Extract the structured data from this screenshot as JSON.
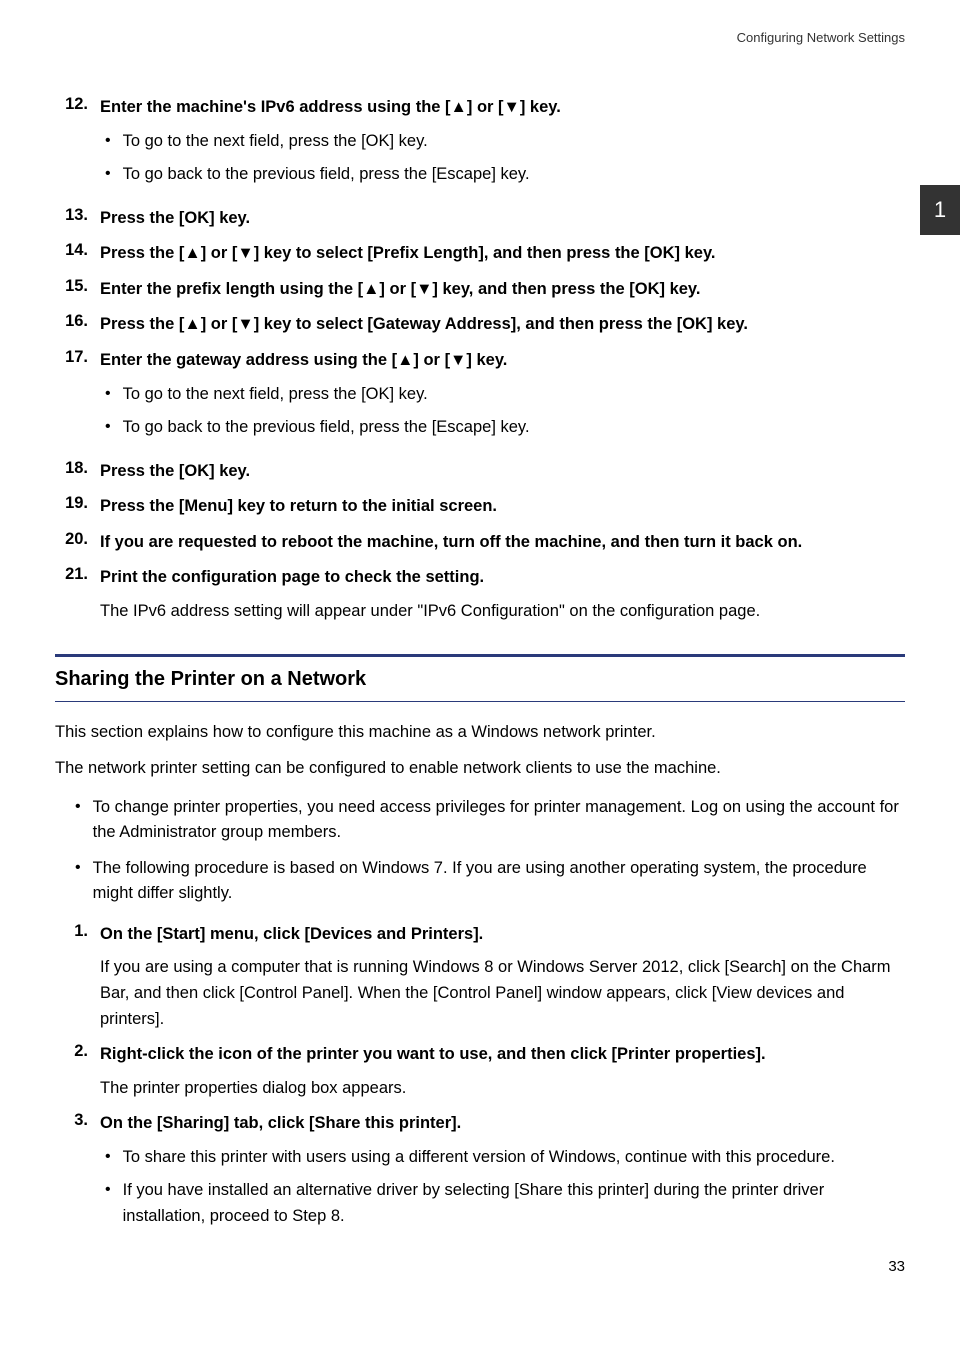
{
  "header": {
    "title": "Configuring Network Settings"
  },
  "sideTab": {
    "number": "1"
  },
  "steps": {
    "s12": {
      "num": "12.",
      "text": "Enter the machine's IPv6 address using the [▲] or [▼] key.",
      "bullets": [
        "To go to the next field, press the [OK] key.",
        "To go back to the previous field, press the [Escape] key."
      ]
    },
    "s13": {
      "num": "13.",
      "text": "Press the [OK] key."
    },
    "s14": {
      "num": "14.",
      "text": "Press the [▲] or [▼] key to select [Prefix Length], and then press the [OK] key."
    },
    "s15": {
      "num": "15.",
      "text": "Enter the prefix length using the [▲] or [▼] key, and then press the [OK] key."
    },
    "s16": {
      "num": "16.",
      "text": "Press the [▲] or [▼] key to select [Gateway Address], and then press the [OK] key."
    },
    "s17": {
      "num": "17.",
      "text": "Enter the gateway address using the [▲] or [▼] key.",
      "bullets": [
        "To go to the next field, press the [OK] key.",
        "To go back to the previous field, press the [Escape] key."
      ]
    },
    "s18": {
      "num": "18.",
      "text": "Press the [OK] key."
    },
    "s19": {
      "num": "19.",
      "text": "Press the [Menu] key to return to the initial screen."
    },
    "s20": {
      "num": "20.",
      "text": "If you are requested to reboot the machine, turn off the machine, and then turn it back on."
    },
    "s21": {
      "num": "21.",
      "text": "Print the configuration page to check the setting.",
      "after": "The IPv6 address setting will appear under \"IPv6 Configuration\" on the configuration page."
    }
  },
  "section": {
    "title": "Sharing the Printer on a Network",
    "para1": "This section explains how to configure this machine as a Windows network printer.",
    "para2": "The network printer setting can be configured to enable network clients to use the machine.",
    "notes": [
      "To change printer properties, you need access privileges for printer management. Log on using the account for the Administrator group members.",
      "The following procedure is based on Windows 7. If you are using another operating system, the procedure might differ slightly."
    ],
    "steps": {
      "p1": {
        "num": "1.",
        "text": "On the [Start] menu, click [Devices and Printers].",
        "after": "If you are using a computer that is running Windows 8 or Windows Server 2012, click [Search] on the Charm Bar, and then click [Control Panel]. When the [Control Panel] window appears, click [View devices and printers]."
      },
      "p2": {
        "num": "2.",
        "text": "Right-click the icon of the printer you want to use, and then click [Printer properties].",
        "after": "The printer properties dialog box appears."
      },
      "p3": {
        "num": "3.",
        "text": "On the [Sharing] tab, click [Share this printer].",
        "bullets": [
          "To share this printer with users using a different version of Windows, continue with this procedure.",
          "If you have installed an alternative driver by selecting [Share this printer] during the printer driver installation, proceed to Step 8."
        ]
      }
    }
  },
  "pageNumber": "33"
}
